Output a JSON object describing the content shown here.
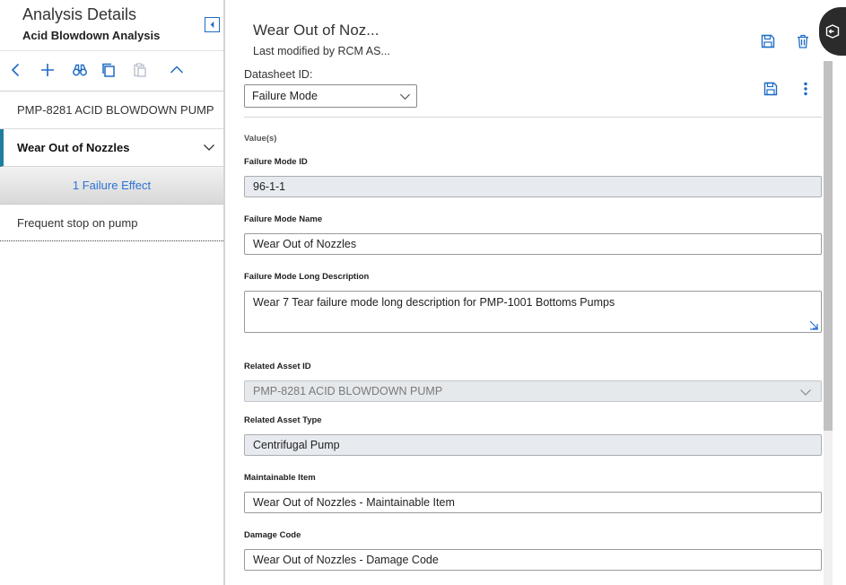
{
  "left_panel": {
    "title": "Analysis Details",
    "subtitle": "Acid Blowdown Analysis",
    "toolbar": [
      "back-icon",
      "add-icon",
      "binoculars-icon",
      "copy-icon",
      "paste-icon",
      "chevron-up-icon"
    ],
    "tree": {
      "asset": "PMP-8281 ACID BLOWDOWN PUMP",
      "failure_mode": "Wear Out of Nozzles",
      "effects_link": "1 Failure Effect",
      "effect": "Frequent stop on pump"
    }
  },
  "right_panel": {
    "title": "Wear Out of Noz...",
    "modified": "Last modified by RCM AS...",
    "datasheet_label": "Datasheet ID:",
    "datasheet_value": "Failure Mode",
    "values_label": "Value(s)",
    "fields": {
      "failure_mode_id": {
        "label": "Failure Mode ID",
        "value": "96-1-1"
      },
      "failure_mode_name": {
        "label": "Failure Mode Name",
        "value": "Wear Out of Nozzles"
      },
      "long_description": {
        "label": "Failure Mode Long Description",
        "value": "Wear 7 Tear failure mode long description for PMP-1001 Bottoms Pumps"
      },
      "related_asset_id": {
        "label": "Related Asset ID",
        "value": "PMP-8281 ACID BLOWDOWN PUMP"
      },
      "related_asset_type": {
        "label": "Related Asset Type",
        "value": "Centrifugal Pump"
      },
      "maintainable_item": {
        "label": "Maintainable Item",
        "value": "Wear Out of Nozzles - Maintainable Item"
      },
      "damage_code": {
        "label": "Damage Code",
        "value": "Wear Out of Nozzles - Damage Code"
      }
    }
  },
  "colors": {
    "accent": "#1e6bc4",
    "selected_bar": "#1f7e9e",
    "link": "#2a73d6",
    "side_tab": "#2b2b2b"
  }
}
